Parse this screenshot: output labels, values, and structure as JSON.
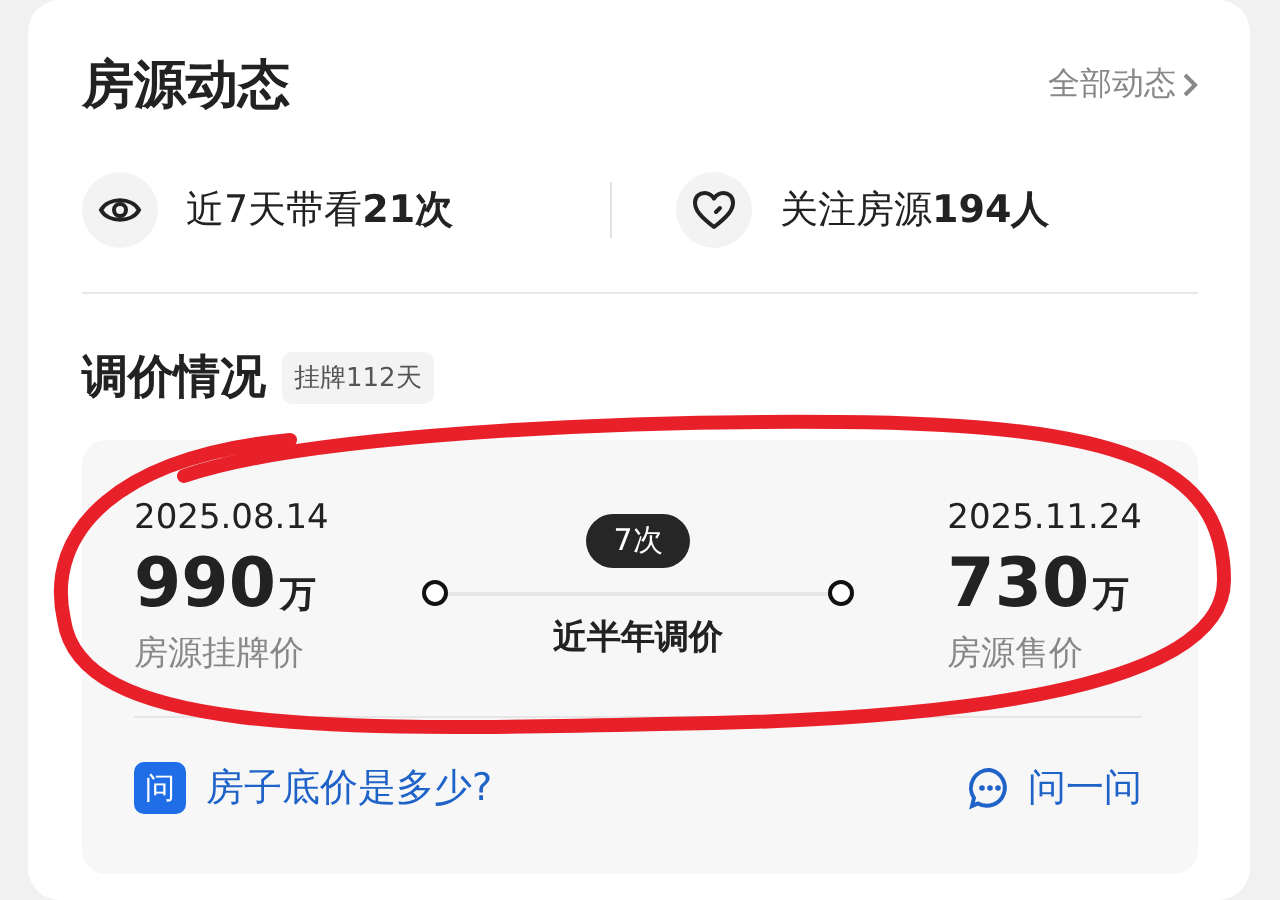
{
  "header": {
    "title": "房源动态",
    "link": "全部动态"
  },
  "stats": [
    {
      "kind": "eye",
      "text": "近7天带看**21次**"
    },
    {
      "kind": "heart",
      "text": "关注房源**194人**"
    }
  ],
  "price_section": {
    "title": "调价情况",
    "badge": "挂牌112天",
    "start": {
      "date": "2025.08.14",
      "value": "990",
      "unit": "万",
      "label": "房源挂牌价"
    },
    "change": {
      "count": "7次",
      "label": "近半年调价"
    },
    "end": {
      "date": "2025.11.24",
      "value": "730",
      "unit": "万",
      "label": "房源售价"
    },
    "ask": {
      "icon_text": "问",
      "question": "房子底价是多少?",
      "action": "问一问"
    }
  }
}
